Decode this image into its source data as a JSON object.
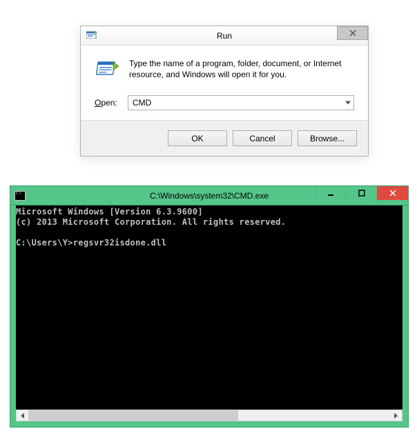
{
  "run": {
    "title": "Run",
    "description": "Type the name of a program, folder, document, or Internet resource, and Windows will open it for you.",
    "open_label": "Open:",
    "open_value": "CMD",
    "buttons": {
      "ok": "OK",
      "cancel": "Cancel",
      "browse": "Browse..."
    }
  },
  "cmd": {
    "title": "C:\\Windows\\system32\\CMD.exe",
    "lines": {
      "l1": "Microsoft Windows [Version 6.3.9600]",
      "l2": "(c) 2013 Microsoft Corporation. All rights reserved.",
      "blank": "",
      "prompt": "C:\\Users\\Y>",
      "command": "regsvr32isdone.dll"
    }
  }
}
